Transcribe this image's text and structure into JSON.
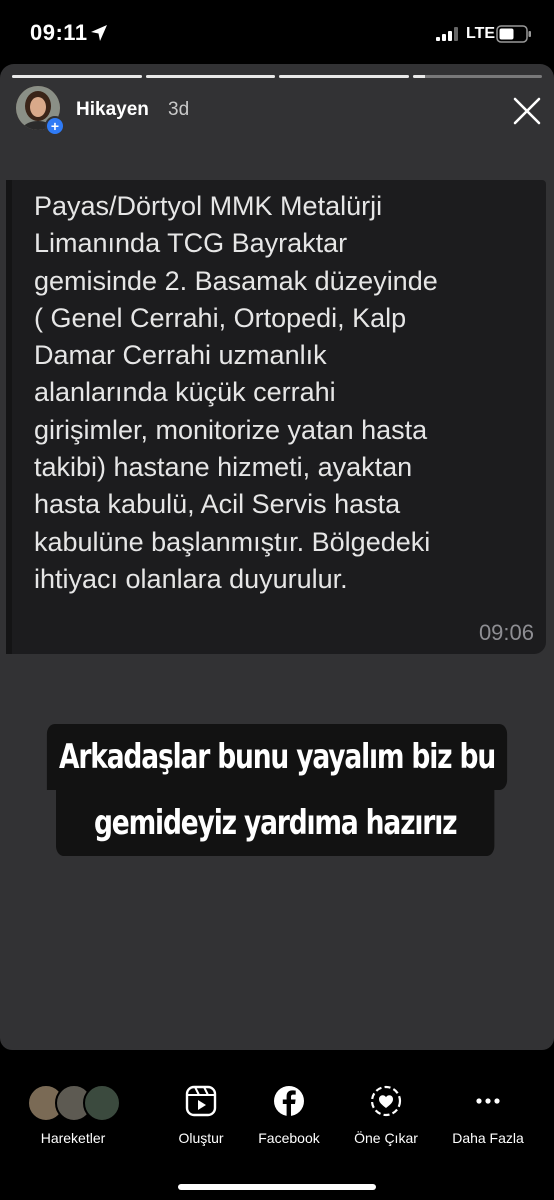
{
  "status_bar": {
    "time": "09:11",
    "network": "LTE",
    "location_icon": "location-arrow-icon",
    "signal_icon": "signal-bars-icon",
    "battery_icon": "battery-icon"
  },
  "story": {
    "user": "Hikayen",
    "age": "3d",
    "progress": [
      1,
      1,
      1,
      0.1
    ],
    "message": {
      "text": "Payas/Dörtyol MMK Metalürji\nLimanında TCG Bayraktar\ngemisinde 2. Basamak düzeyinde\n( Genel Cerrahi, Ortopedi, Kalp\nDamar Cerrahi uzmanlık\nalanlarında küçük cerrahi\ngirişimler, monitorize yatan hasta\ntakibi) hastane hizmeti, ayaktan\nhasta kabulü, Acil Servis hasta\nkabulüne başlanmıştır. Bölgedeki\nihtiyacı olanlara duyurulur.",
      "time": "09:06"
    },
    "caption": {
      "line1": "Arkadaşlar bunu yayalım biz bu",
      "line2": "gemideyiz yardıma hazırız"
    }
  },
  "toolbar": {
    "items": [
      {
        "label": "Hareketler",
        "icon": "activity-avatars"
      },
      {
        "label": "Oluştur",
        "icon": "create-play-icon"
      },
      {
        "label": "Facebook",
        "icon": "facebook-icon"
      },
      {
        "label": "Öne Çıkar",
        "icon": "highlight-heart-icon"
      },
      {
        "label": "Daha Fazla",
        "icon": "more-dots-icon"
      }
    ]
  },
  "colors": {
    "story_bg": "#323234",
    "bubble_bg": "#1c1c1e",
    "caption_bg": "#121212",
    "accent_blue": "#2f7bf6"
  }
}
